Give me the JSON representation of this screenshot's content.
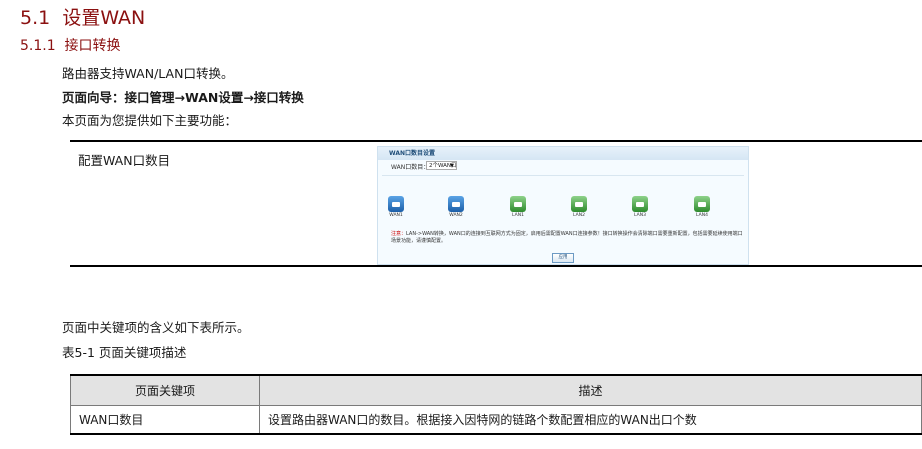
{
  "section": {
    "number": "5.1",
    "title": "设置WAN"
  },
  "subsection": {
    "number": "5.1.1",
    "title": "接口转换"
  },
  "intro": "路由器支持WAN/LAN口转换。",
  "navigation": "页面向导：接口管理→WAN设置→接口转换",
  "provides": "本页面为您提供如下主要功能：",
  "function_row": {
    "label": "配置WAN口数目"
  },
  "screenshot": {
    "title": "WAN口数目设置",
    "field_label": "WAN口数目：",
    "field_value": "2个WAN口",
    "ports": [
      {
        "type": "wan",
        "label": "WAN1"
      },
      {
        "type": "wan",
        "label": "WAN2"
      },
      {
        "type": "lan",
        "label": "LAN1"
      },
      {
        "type": "lan",
        "label": "LAN2"
      },
      {
        "type": "lan",
        "label": "LAN3"
      },
      {
        "type": "lan",
        "label": "LAN4"
      }
    ],
    "note_prefix": "注意：",
    "note_text": "LAN->WAN转换，WAN口的连接到互联网方式为固定，启用后需配置WAN口连接参数！接口转换操作会清除端口需要重新配置，包括需要延续使用端口场景功能，请谨慎配置。",
    "button": "应用"
  },
  "table_intro": "页面中关键项的含义如下表所示。",
  "table_caption": "表5-1 页面关键项描述",
  "table": {
    "headers": [
      "页面关键项",
      "描述"
    ],
    "rows": [
      [
        "WAN口数目",
        "设置路由器WAN口的数目。根据接入因特网的链路个数配置相应的WAN出口个数"
      ]
    ]
  }
}
